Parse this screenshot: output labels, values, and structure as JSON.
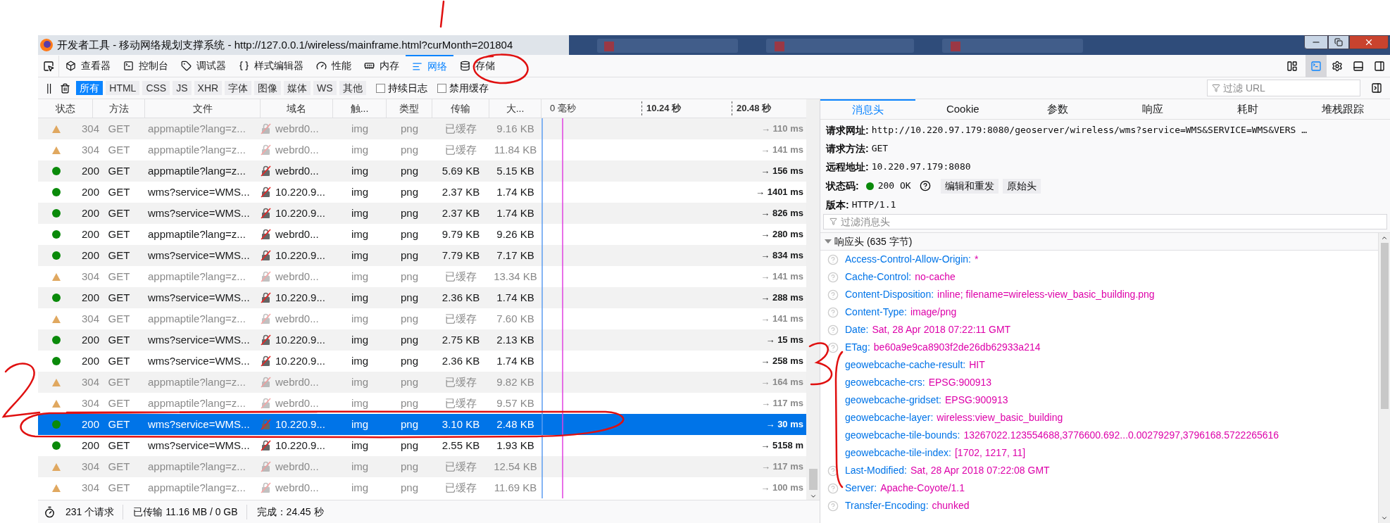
{
  "window": {
    "title": "开发者工具 - 移动网络规划支撑系统 - http://127.0.0.1/wireless/mainframe.html?curMonth=201804"
  },
  "toolbar": {
    "tools": [
      {
        "label": "查看器",
        "selected": false
      },
      {
        "label": "控制台",
        "selected": false
      },
      {
        "label": "调试器",
        "selected": false
      },
      {
        "label": "样式编辑器",
        "selected": false
      },
      {
        "label": "性能",
        "selected": false
      },
      {
        "label": "内存",
        "selected": false
      },
      {
        "label": "网络",
        "selected": true
      },
      {
        "label": "存储",
        "selected": false
      }
    ]
  },
  "filter_bar": {
    "pause": "||",
    "types": [
      {
        "label": "所有",
        "selected": true
      },
      {
        "label": "HTML",
        "selected": false
      },
      {
        "label": "CSS",
        "selected": false
      },
      {
        "label": "JS",
        "selected": false
      },
      {
        "label": "XHR",
        "selected": false
      },
      {
        "label": "字体",
        "selected": false
      },
      {
        "label": "图像",
        "selected": false
      },
      {
        "label": "媒体",
        "selected": false
      },
      {
        "label": "WS",
        "selected": false
      },
      {
        "label": "其他",
        "selected": false
      }
    ],
    "options": [
      {
        "label": "持续日志",
        "checked": false
      },
      {
        "label": "禁用缓存",
        "checked": false
      }
    ],
    "search": {
      "placeholder": "过滤 URL"
    }
  },
  "table": {
    "columns": [
      "状态",
      "方法",
      "文件",
      "域名",
      "触...",
      "类型",
      "传输",
      "大..."
    ],
    "timeline_ticks": [
      "0 毫秒",
      "10.24 秒",
      "20.48 秒"
    ],
    "rows": [
      {
        "kind": "cached",
        "status": "304",
        "method": "GET",
        "file": "appmaptile?lang=z...",
        "domain": "webrd0...",
        "cause": "img",
        "type": "png",
        "transferred": "已缓存",
        "size": "9.16 KB",
        "time": "→ 110 ms",
        "selected": false
      },
      {
        "kind": "cached",
        "status": "304",
        "method": "GET",
        "file": "appmaptile?lang=z...",
        "domain": "webrd0...",
        "cause": "img",
        "type": "png",
        "transferred": "已缓存",
        "size": "11.84 KB",
        "time": "→ 141 ms",
        "selected": false
      },
      {
        "kind": "ok",
        "status": "200",
        "method": "GET",
        "file": "appmaptile?lang=z...",
        "domain": "webrd0...",
        "cause": "img",
        "type": "png",
        "transferred": "5.69 KB",
        "size": "5.15 KB",
        "time": "→ 156 ms",
        "selected": false
      },
      {
        "kind": "ok",
        "status": "200",
        "method": "GET",
        "file": "wms?service=WMS...",
        "domain": "10.220.9...",
        "cause": "img",
        "type": "png",
        "transferred": "2.37 KB",
        "size": "1.74 KB",
        "time": "→ 1401 ms",
        "selected": false
      },
      {
        "kind": "ok",
        "status": "200",
        "method": "GET",
        "file": "wms?service=WMS...",
        "domain": "10.220.9...",
        "cause": "img",
        "type": "png",
        "transferred": "2.37 KB",
        "size": "1.74 KB",
        "time": "→ 826 ms",
        "selected": false
      },
      {
        "kind": "ok",
        "status": "200",
        "method": "GET",
        "file": "appmaptile?lang=z...",
        "domain": "webrd0...",
        "cause": "img",
        "type": "png",
        "transferred": "9.79 KB",
        "size": "9.26 KB",
        "time": "→ 280 ms",
        "selected": false
      },
      {
        "kind": "ok",
        "status": "200",
        "method": "GET",
        "file": "wms?service=WMS...",
        "domain": "10.220.9...",
        "cause": "img",
        "type": "png",
        "transferred": "7.79 KB",
        "size": "7.17 KB",
        "time": "→ 834 ms",
        "selected": false
      },
      {
        "kind": "cached",
        "status": "304",
        "method": "GET",
        "file": "appmaptile?lang=z...",
        "domain": "webrd0...",
        "cause": "img",
        "type": "png",
        "transferred": "已缓存",
        "size": "13.34 KB",
        "time": "→ 141 ms",
        "selected": false
      },
      {
        "kind": "ok",
        "status": "200",
        "method": "GET",
        "file": "wms?service=WMS...",
        "domain": "10.220.9...",
        "cause": "img",
        "type": "png",
        "transferred": "2.36 KB",
        "size": "1.74 KB",
        "time": "→ 288 ms",
        "selected": false
      },
      {
        "kind": "cached",
        "status": "304",
        "method": "GET",
        "file": "appmaptile?lang=z...",
        "domain": "webrd0...",
        "cause": "img",
        "type": "png",
        "transferred": "已缓存",
        "size": "7.60 KB",
        "time": "→ 141 ms",
        "selected": false
      },
      {
        "kind": "ok",
        "status": "200",
        "method": "GET",
        "file": "wms?service=WMS...",
        "domain": "10.220.9...",
        "cause": "img",
        "type": "png",
        "transferred": "2.75 KB",
        "size": "2.13 KB",
        "time": "→ 15 ms",
        "selected": false
      },
      {
        "kind": "ok",
        "status": "200",
        "method": "GET",
        "file": "wms?service=WMS...",
        "domain": "10.220.9...",
        "cause": "img",
        "type": "png",
        "transferred": "2.36 KB",
        "size": "1.74 KB",
        "time": "→ 258 ms",
        "selected": false
      },
      {
        "kind": "cached",
        "status": "304",
        "method": "GET",
        "file": "appmaptile?lang=z...",
        "domain": "webrd0...",
        "cause": "img",
        "type": "png",
        "transferred": "已缓存",
        "size": "9.82 KB",
        "time": "→ 164 ms",
        "selected": false
      },
      {
        "kind": "cached",
        "status": "304",
        "method": "GET",
        "file": "appmaptile?lang=z...",
        "domain": "webrd0...",
        "cause": "img",
        "type": "png",
        "transferred": "已缓存",
        "size": "9.57 KB",
        "time": "→ 117 ms",
        "selected": false
      },
      {
        "kind": "ok",
        "status": "200",
        "method": "GET",
        "file": "wms?service=WMS...",
        "domain": "10.220.9...",
        "cause": "img",
        "type": "png",
        "transferred": "3.10 KB",
        "size": "2.48 KB",
        "time": "→ 30 ms",
        "selected": true
      },
      {
        "kind": "ok",
        "status": "200",
        "method": "GET",
        "file": "wms?service=WMS...",
        "domain": "10.220.9...",
        "cause": "img",
        "type": "png",
        "transferred": "2.55 KB",
        "size": "1.93 KB",
        "time": "→ 5158 m",
        "selected": false
      },
      {
        "kind": "cached",
        "status": "304",
        "method": "GET",
        "file": "appmaptile?lang=z...",
        "domain": "webrd0...",
        "cause": "img",
        "type": "png",
        "transferred": "已缓存",
        "size": "12.54 KB",
        "time": "→ 117 ms",
        "selected": false
      },
      {
        "kind": "cached",
        "status": "304",
        "method": "GET",
        "file": "appmaptile?lang=z...",
        "domain": "webrd0...",
        "cause": "img",
        "type": "png",
        "transferred": "已缓存",
        "size": "11.69 KB",
        "time": "→ 100 ms",
        "selected": false
      }
    ]
  },
  "status_bar": {
    "requests": "231 个请求",
    "transferred": "已传输 11.16 MB / 0 GB",
    "finished": "完成：24.45 秒"
  },
  "details": {
    "tabs": [
      {
        "label": "消息头",
        "selected": true
      },
      {
        "label": "Cookie",
        "selected": false
      },
      {
        "label": "参数",
        "selected": false
      },
      {
        "label": "响应",
        "selected": false
      },
      {
        "label": "耗时",
        "selected": false
      },
      {
        "label": "堆栈跟踪",
        "selected": false
      }
    ],
    "summary": [
      {
        "label": "请求网址:",
        "value": "http://10.220.97.179:8080/geoserver/wireless/wms?service=WMS&SERVICE=WMS&VERS …"
      },
      {
        "label": "请求方法:",
        "value": "GET"
      },
      {
        "label": "远程地址:",
        "value": "10.220.97.179:8080"
      }
    ],
    "status": {
      "label": "状态码:",
      "value": "200 OK",
      "buttons": [
        "编辑和重发",
        "原始头"
      ]
    },
    "version": {
      "label": "版本:",
      "value": "HTTP/1.1"
    },
    "filter": {
      "placeholder": "过滤消息头"
    },
    "section": {
      "title": "响应头 (635 字节)",
      "expanded": true
    },
    "headers": [
      {
        "name": "Access-Control-Allow-Origin:",
        "value": "*",
        "help": true
      },
      {
        "name": "Cache-Control:",
        "value": "no-cache",
        "help": true
      },
      {
        "name": "Content-Disposition:",
        "value": "inline; filename=wireless-view_basic_building.png",
        "help": true
      },
      {
        "name": "Content-Type:",
        "value": "image/png",
        "help": true
      },
      {
        "name": "Date:",
        "value": "Sat, 28 Apr 2018 07:22:11 GMT",
        "help": true
      },
      {
        "name": "ETag:",
        "value": "be60a9e9ca8903f2de26db62933a214",
        "help": true
      },
      {
        "name": "geowebcache-cache-result:",
        "value": "HIT",
        "help": false
      },
      {
        "name": "geowebcache-crs:",
        "value": "EPSG:900913",
        "help": false
      },
      {
        "name": "geowebcache-gridset:",
        "value": "EPSG:900913",
        "help": false
      },
      {
        "name": "geowebcache-layer:",
        "value": "wireless:view_basic_building",
        "help": false
      },
      {
        "name": "geowebcache-tile-bounds:",
        "value": "13267022.123554688,3776600.692...0.00279297,3796168.5722265616",
        "help": false
      },
      {
        "name": "geowebcache-tile-index:",
        "value": "[1702, 1217, 11]",
        "help": false
      },
      {
        "name": "Last-Modified:",
        "value": "Sat, 28 Apr 2018 07:22:08 GMT",
        "help": true
      },
      {
        "name": "Server:",
        "value": "Apache-Coyote/1.1",
        "help": true
      },
      {
        "name": "Transfer-Encoding:",
        "value": "chunked",
        "help": true
      }
    ]
  }
}
